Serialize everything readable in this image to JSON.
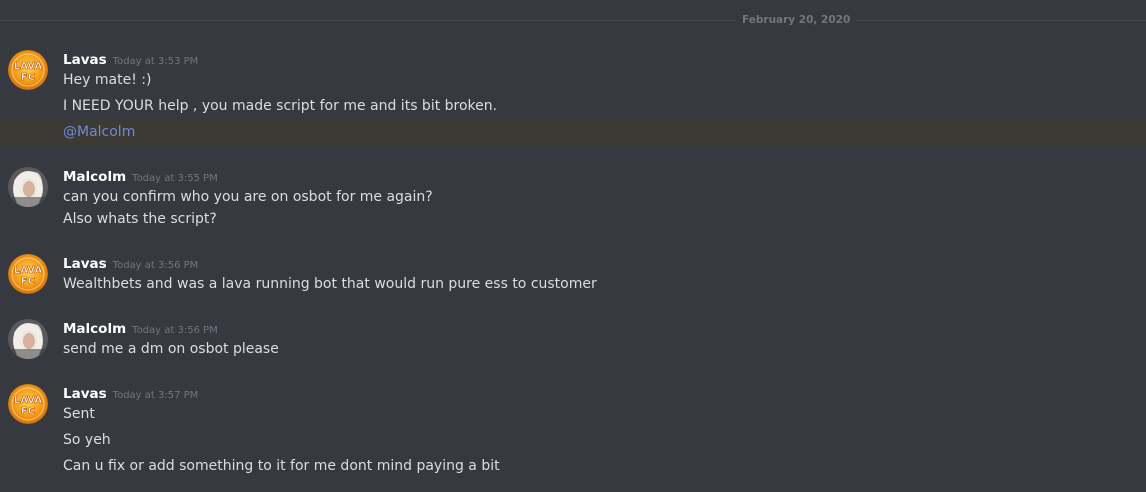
{
  "date_divider": "February 20, 2020",
  "messages": [
    {
      "author": "Lavas",
      "avatar": "lava-fc-avatar",
      "timestamp": "Today at 3:53 PM",
      "lines": [
        "Hey mate! :)",
        "I NEED YOUR help , you made script for me and its bit broken.",
        "@Malcolm"
      ]
    },
    {
      "author": "Malcolm",
      "avatar": "girl-avatar",
      "timestamp": "Today at 3:55 PM",
      "lines": [
        "can you confirm who you are on osbot for me again?",
        "Also whats the script?"
      ]
    },
    {
      "author": "Lavas",
      "avatar": "lava-fc-avatar",
      "timestamp": "Today at 3:56 PM",
      "lines": [
        "Wealthbets and was a lava running bot that would run pure ess to customer"
      ]
    },
    {
      "author": "Malcolm",
      "avatar": "girl-avatar",
      "timestamp": "Today at 3:56 PM",
      "lines": [
        "send me a dm on osbot please"
      ]
    },
    {
      "author": "Lavas",
      "avatar": "lava-fc-avatar",
      "timestamp": "Today at 3:57 PM",
      "lines": [
        "Sent",
        "So yeh",
        "Can u fix or add something to it for me dont mind paying a bit"
      ]
    }
  ],
  "avatar_text": {
    "top": "LAVA",
    "bottom": "FC"
  },
  "colors": {
    "background": "#36393f",
    "mention_highlight": "#3c3a35",
    "mention_text": "#7289da",
    "username": "#ffffff",
    "timestamp": "#72767d",
    "message_text": "#dcddde",
    "avatar_orange": "#f0a21a"
  }
}
